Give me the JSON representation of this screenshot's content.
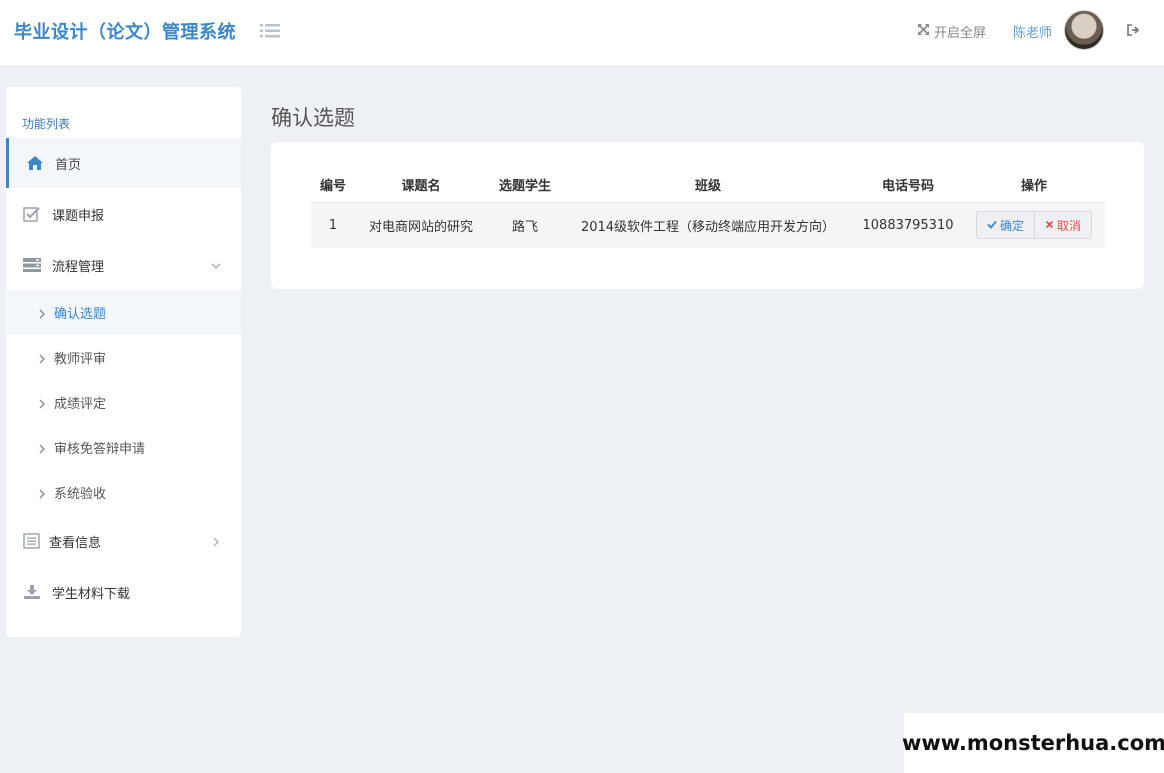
{
  "header": {
    "brand": "毕业设计（论文）管理系统",
    "fullscreen_label": "开启全屏",
    "username": "陈老师",
    "icons": {
      "menu": "list-icon",
      "fullscreen": "expand-icon",
      "logout": "sign-out-icon"
    }
  },
  "sidebar": {
    "title": "功能列表",
    "items": [
      {
        "label": "首页",
        "icon": "home-icon"
      },
      {
        "label": "课题申报",
        "icon": "check-square-icon"
      },
      {
        "label": "流程管理",
        "icon": "server-icon"
      },
      {
        "label": "查看信息",
        "icon": "list-alt-icon"
      },
      {
        "label": "学生材料下载",
        "icon": "download-icon"
      }
    ],
    "sub_items": [
      {
        "label": "确认选题"
      },
      {
        "label": "教师评审"
      },
      {
        "label": "成绩评定"
      },
      {
        "label": "审核免答辩申请"
      },
      {
        "label": "系统验收"
      }
    ]
  },
  "main": {
    "page_title": "确认选题",
    "table": {
      "headers": [
        "编号",
        "课题名",
        "选题学生",
        "班级",
        "电话号码",
        "操作"
      ],
      "rows": [
        {
          "id": "1",
          "topic": "对电商网站的研究",
          "student": "路飞",
          "class": "2014级软件工程（移动终端应用开发方向）",
          "phone": "10883795310",
          "confirm_label": "确定",
          "cancel_label": "取消"
        }
      ]
    }
  },
  "colors": {
    "accent": "#3a86c8",
    "danger": "#d9534f",
    "background": "#edf0f5"
  },
  "watermark": "www.monsterhua.com"
}
